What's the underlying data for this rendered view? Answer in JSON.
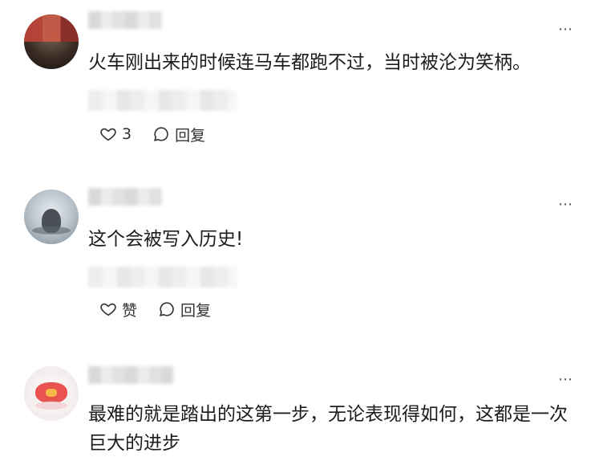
{
  "comments": [
    {
      "text": "火车刚出来的时候连马车都跑不过，当时被沦为笑柄。",
      "like_label": "3",
      "reply_label": "回复",
      "more_label": "⋯"
    },
    {
      "text": "这个会被写入历史!",
      "like_label": "赞",
      "reply_label": "回复",
      "more_label": "⋯"
    },
    {
      "text": "最难的就是踏出的这第一步，无论表现得如何，这都是一次巨大的进步",
      "more_label": "⋯"
    }
  ],
  "icons": {
    "like": "heart-icon",
    "reply": "comment-bubble-icon",
    "more": "more-icon"
  }
}
